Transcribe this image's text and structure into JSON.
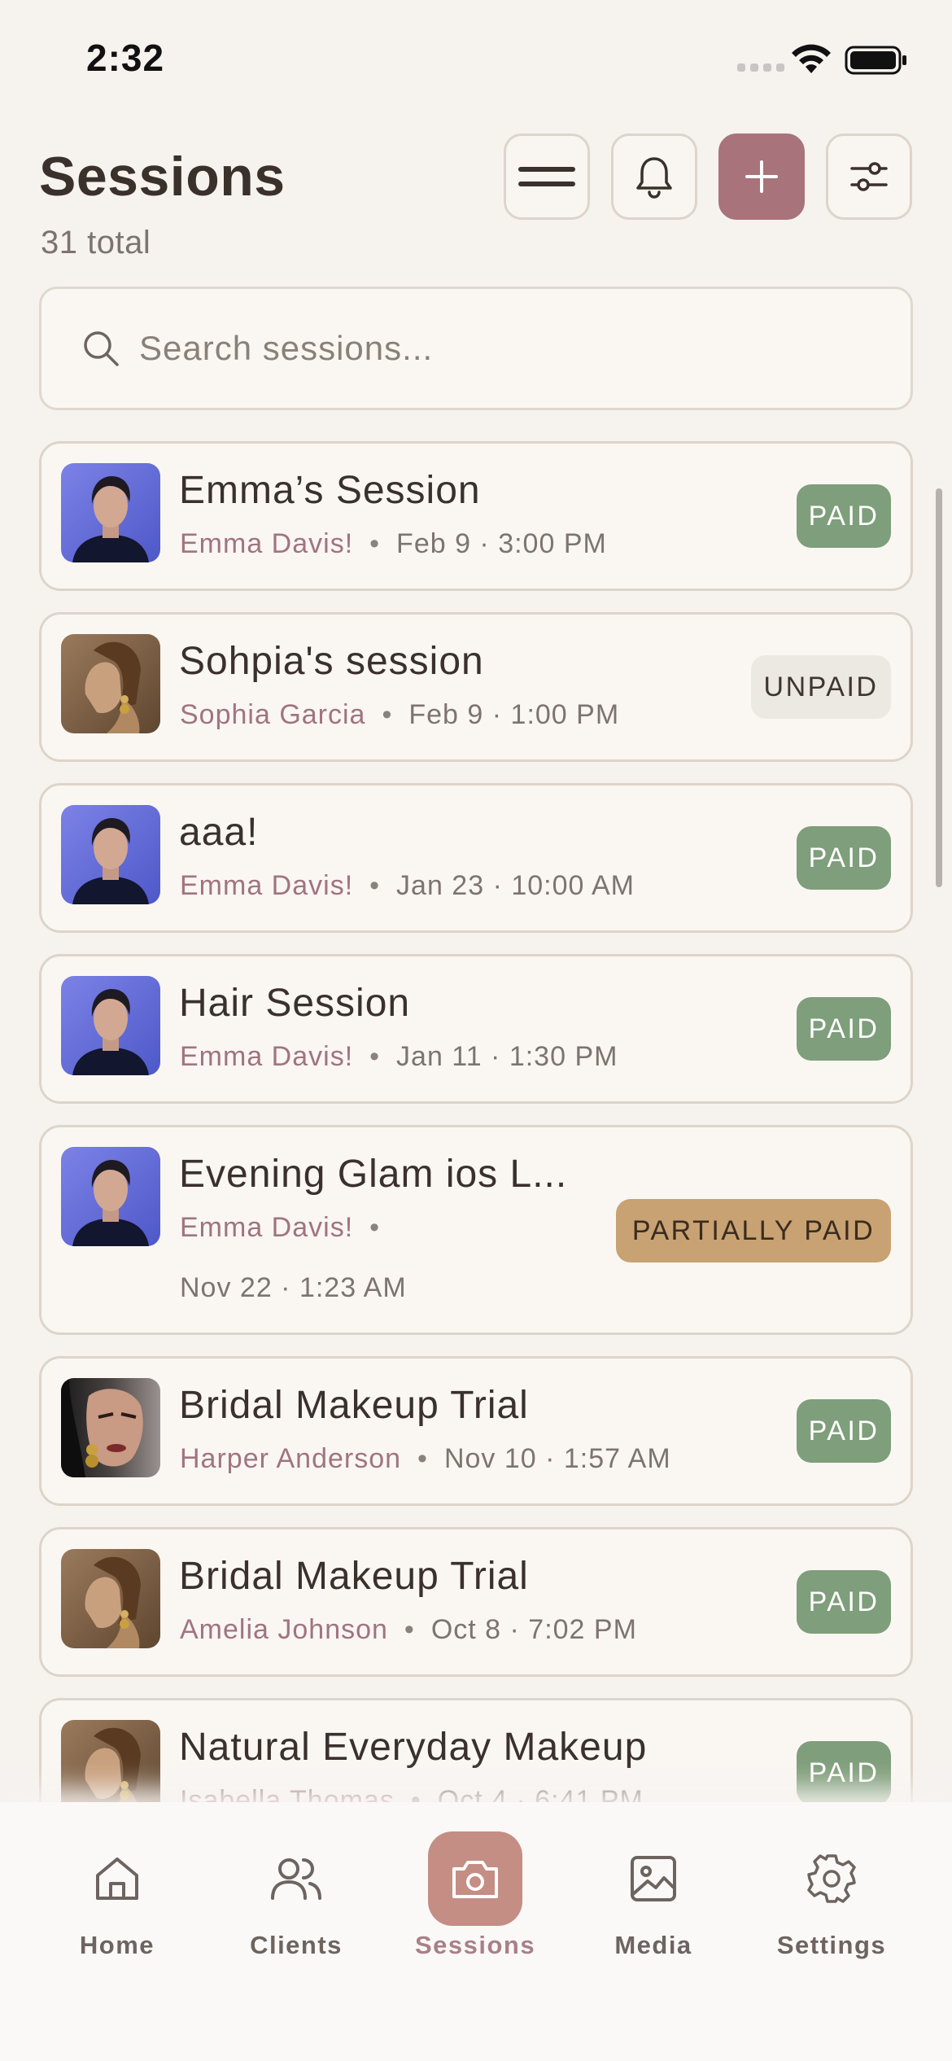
{
  "status_bar": {
    "time": "2:32"
  },
  "header": {
    "title": "Sessions",
    "total": "31 total",
    "buttons": [
      "menu-icon",
      "bell-icon",
      "plus-icon",
      "sliders-icon"
    ]
  },
  "search": {
    "placeholder": "Search sessions...",
    "value": ""
  },
  "sessions": [
    {
      "title": "Emma’s Session",
      "client": "Emma Davis!",
      "when": "Feb 9 · 3:00 PM",
      "status": "PAID",
      "avatar": "emma-portrait"
    },
    {
      "title": "Sohpia's session",
      "client": "Sophia Garcia",
      "when": "Feb 9 · 1:00 PM",
      "status": "UNPAID",
      "avatar": "sophia-portrait"
    },
    {
      "title": "aaa!",
      "client": "Emma Davis!",
      "when": "Jan 23 · 10:00 AM",
      "status": "PAID",
      "avatar": "emma-portrait"
    },
    {
      "title": "Hair Session",
      "client": "Emma Davis!",
      "when": "Jan 11 · 1:30 PM",
      "status": "PAID",
      "avatar": "emma-portrait"
    },
    {
      "title": "Evening Glam ios L...",
      "client": "Emma Davis!",
      "when": "Nov 22 · 1:23 AM",
      "status": "PARTIALLY PAID",
      "avatar": "emma-portrait"
    },
    {
      "title": "Bridal Makeup Trial",
      "client": "Harper Anderson",
      "when": "Nov 10 · 1:57 AM",
      "status": "PAID",
      "avatar": "harper-portrait"
    },
    {
      "title": "Bridal Makeup Trial",
      "client": "Amelia Johnson",
      "when": "Oct 8 · 7:02 PM",
      "status": "PAID",
      "avatar": "amelia-portrait"
    },
    {
      "title": "Natural Everyday Makeup",
      "client": "Isabella Thomas",
      "when": "Oct 4 · 6:41 PM",
      "status": "PAID",
      "avatar": "isabella-portrait"
    }
  ],
  "tabs": [
    {
      "label": "Home",
      "icon": "home-icon",
      "active": false
    },
    {
      "label": "Clients",
      "icon": "users-icon",
      "active": false
    },
    {
      "label": "Sessions",
      "icon": "camera-icon",
      "active": true
    },
    {
      "label": "Media",
      "icon": "image-icon",
      "active": false
    },
    {
      "label": "Settings",
      "icon": "gear-icon",
      "active": false
    }
  ],
  "colors": {
    "background": "#f6f3ef",
    "accent": "#a8737a",
    "paid": "#7f9e7b",
    "unpaid": "#ece8e2",
    "partially_paid": "#c8a272",
    "client_name": "#a07480"
  }
}
